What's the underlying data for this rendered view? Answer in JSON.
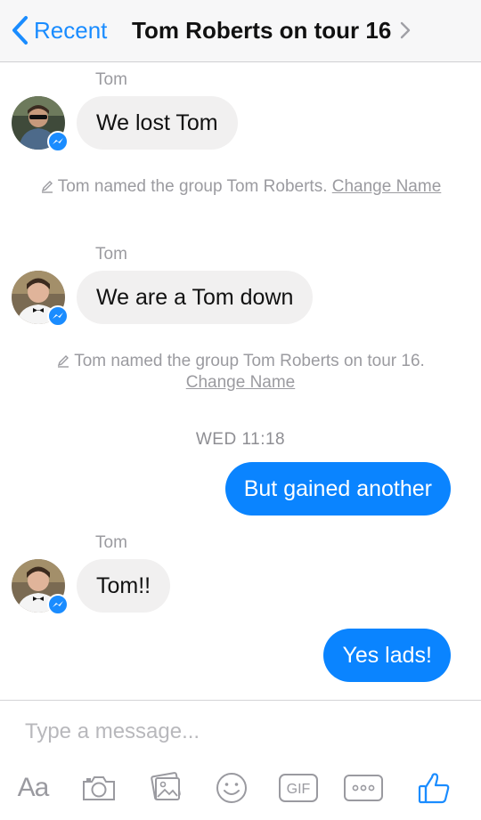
{
  "header": {
    "back_label": "Recent",
    "title": "Tom Roberts on tour 16"
  },
  "messages": [
    {
      "type": "incoming",
      "sender": "Tom",
      "text": "We lost Tom"
    },
    {
      "type": "system",
      "text": "Tom named the group Tom Roberts.",
      "link": "Change Name"
    },
    {
      "type": "incoming",
      "sender": "Tom",
      "text": "We are a Tom down"
    },
    {
      "type": "system",
      "text": "Tom named the group Tom Roberts on tour 16.",
      "link": "Change Name"
    },
    {
      "type": "timestamp",
      "text": "WED 11:18"
    },
    {
      "type": "outgoing",
      "text": "But gained another"
    },
    {
      "type": "incoming",
      "sender": "Tom",
      "text": "Tom!!"
    },
    {
      "type": "outgoing",
      "text": "Yes lads!"
    }
  ],
  "composer": {
    "placeholder": "Type a message...",
    "aa_label": "Aa",
    "gif_label": "GIF",
    "icons": [
      "text-format-icon",
      "camera-icon",
      "photo-gallery-icon",
      "emoji-icon",
      "gif-icon",
      "more-icon",
      "like-icon"
    ]
  },
  "colors": {
    "accent": "#1a8cff",
    "outgoing_bubble": "#0a84ff",
    "incoming_bubble": "#f1f0f0",
    "secondary_text": "#9b9ba0"
  }
}
